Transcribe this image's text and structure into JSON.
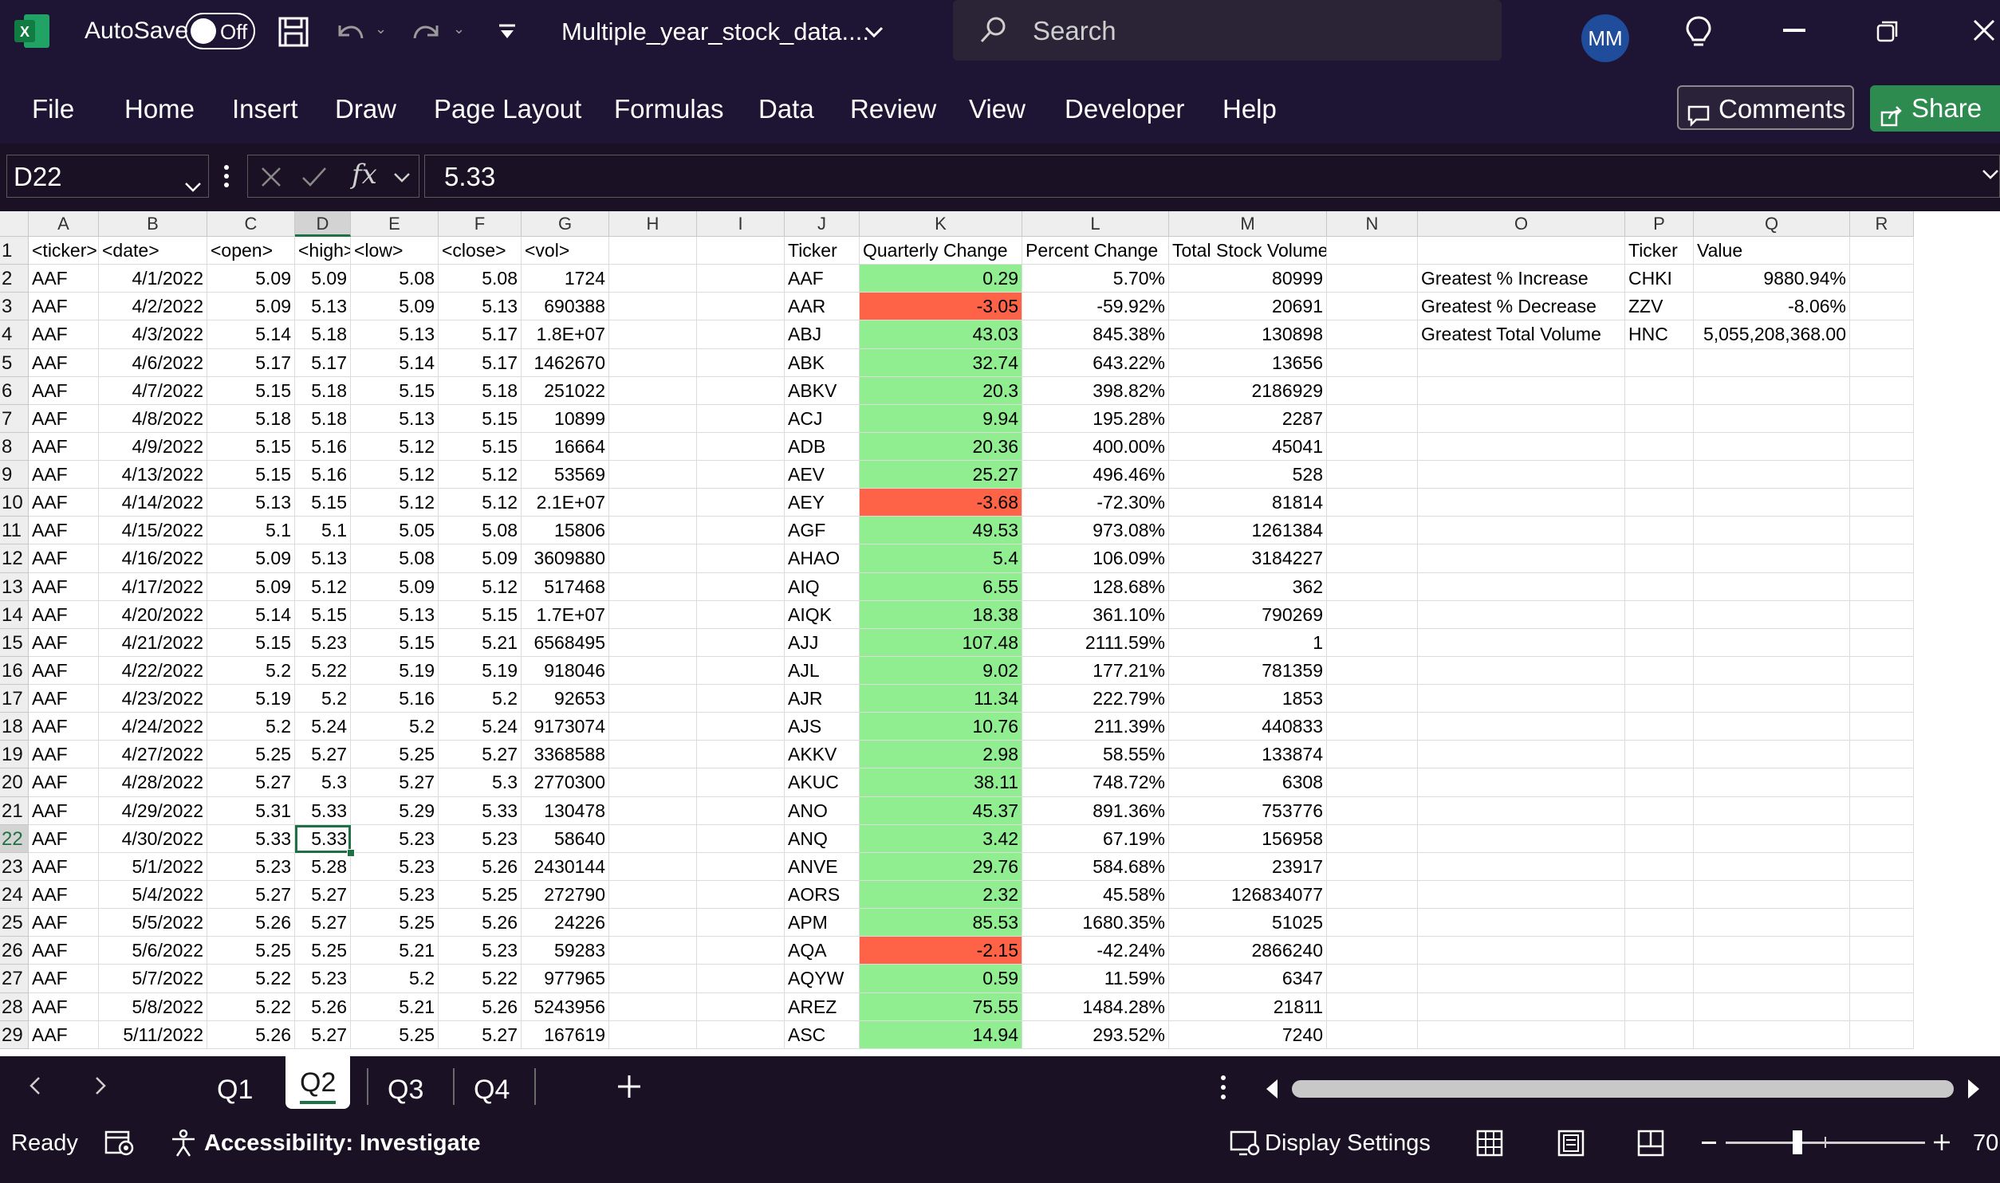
{
  "titlebar": {
    "autosave_label": "AutoSave",
    "autosave_state": "Off",
    "filename": "Multiple_year_stock_data....",
    "search_placeholder": "Search",
    "avatar_initials": "MM"
  },
  "ribbon": {
    "tabs": [
      "File",
      "Home",
      "Insert",
      "Draw",
      "Page Layout",
      "Formulas",
      "Data",
      "Review",
      "View",
      "Developer",
      "Help"
    ],
    "comments_label": "Comments",
    "share_label": "Share"
  },
  "formula_bar": {
    "name_box": "D22",
    "fx_label": "fx",
    "value": "5.33"
  },
  "columns": [
    "A",
    "B",
    "C",
    "D",
    "E",
    "F",
    "G",
    "H",
    "I",
    "J",
    "K",
    "L",
    "M",
    "N",
    "O",
    "P",
    "Q",
    "R"
  ],
  "selected_column": "D",
  "selected_row": 22,
  "active_cell": "D22",
  "row_numbers": [
    1,
    2,
    3,
    4,
    5,
    6,
    7,
    8,
    9,
    10,
    11,
    12,
    13,
    14,
    15,
    16,
    17,
    18,
    19,
    20,
    21,
    22,
    23,
    24,
    25,
    26,
    27,
    28,
    29
  ],
  "raw_headers": [
    "<ticker>",
    "<date>",
    "<open>",
    "<high>",
    "<low>",
    "<close>",
    "<vol>"
  ],
  "raw_rows": [
    [
      "AAF",
      "4/1/2022",
      "5.09",
      "5.09",
      "5.08",
      "5.08",
      "1724"
    ],
    [
      "AAF",
      "4/2/2022",
      "5.09",
      "5.13",
      "5.09",
      "5.13",
      "690388"
    ],
    [
      "AAF",
      "4/3/2022",
      "5.14",
      "5.18",
      "5.13",
      "5.17",
      "1.8E+07"
    ],
    [
      "AAF",
      "4/6/2022",
      "5.17",
      "5.17",
      "5.14",
      "5.17",
      "1462670"
    ],
    [
      "AAF",
      "4/7/2022",
      "5.15",
      "5.18",
      "5.15",
      "5.18",
      "251022"
    ],
    [
      "AAF",
      "4/8/2022",
      "5.18",
      "5.18",
      "5.13",
      "5.15",
      "10899"
    ],
    [
      "AAF",
      "4/9/2022",
      "5.15",
      "5.16",
      "5.12",
      "5.15",
      "16664"
    ],
    [
      "AAF",
      "4/13/2022",
      "5.15",
      "5.16",
      "5.12",
      "5.12",
      "53569"
    ],
    [
      "AAF",
      "4/14/2022",
      "5.13",
      "5.15",
      "5.12",
      "5.12",
      "2.1E+07"
    ],
    [
      "AAF",
      "4/15/2022",
      "5.1",
      "5.1",
      "5.05",
      "5.08",
      "15806"
    ],
    [
      "AAF",
      "4/16/2022",
      "5.09",
      "5.13",
      "5.08",
      "5.09",
      "3609880"
    ],
    [
      "AAF",
      "4/17/2022",
      "5.09",
      "5.12",
      "5.09",
      "5.12",
      "517468"
    ],
    [
      "AAF",
      "4/20/2022",
      "5.14",
      "5.15",
      "5.13",
      "5.15",
      "1.7E+07"
    ],
    [
      "AAF",
      "4/21/2022",
      "5.15",
      "5.23",
      "5.15",
      "5.21",
      "6568495"
    ],
    [
      "AAF",
      "4/22/2022",
      "5.2",
      "5.22",
      "5.19",
      "5.19",
      "918046"
    ],
    [
      "AAF",
      "4/23/2022",
      "5.19",
      "5.2",
      "5.16",
      "5.2",
      "92653"
    ],
    [
      "AAF",
      "4/24/2022",
      "5.2",
      "5.24",
      "5.2",
      "5.24",
      "9173074"
    ],
    [
      "AAF",
      "4/27/2022",
      "5.25",
      "5.27",
      "5.25",
      "5.27",
      "3368588"
    ],
    [
      "AAF",
      "4/28/2022",
      "5.27",
      "5.3",
      "5.27",
      "5.3",
      "2770300"
    ],
    [
      "AAF",
      "4/29/2022",
      "5.31",
      "5.33",
      "5.29",
      "5.33",
      "130478"
    ],
    [
      "AAF",
      "4/30/2022",
      "5.33",
      "5.33",
      "5.23",
      "5.23",
      "58640"
    ],
    [
      "AAF",
      "5/1/2022",
      "5.23",
      "5.28",
      "5.23",
      "5.26",
      "2430144"
    ],
    [
      "AAF",
      "5/4/2022",
      "5.27",
      "5.27",
      "5.23",
      "5.25",
      "272790"
    ],
    [
      "AAF",
      "5/5/2022",
      "5.26",
      "5.27",
      "5.25",
      "5.26",
      "24226"
    ],
    [
      "AAF",
      "5/6/2022",
      "5.25",
      "5.25",
      "5.21",
      "5.23",
      "59283"
    ],
    [
      "AAF",
      "5/7/2022",
      "5.22",
      "5.23",
      "5.2",
      "5.22",
      "977965"
    ],
    [
      "AAF",
      "5/8/2022",
      "5.22",
      "5.26",
      "5.21",
      "5.26",
      "5243956"
    ],
    [
      "AAF",
      "5/11/2022",
      "5.26",
      "5.27",
      "5.25",
      "5.27",
      "167619"
    ]
  ],
  "summary_headers": [
    "Ticker",
    "Quarterly Change",
    "Percent Change",
    "Total Stock Volume"
  ],
  "summary_rows": [
    [
      "AAF",
      "0.29",
      "5.70%",
      "80999",
      "pos"
    ],
    [
      "AAR",
      "-3.05",
      "-59.92%",
      "20691",
      "neg"
    ],
    [
      "ABJ",
      "43.03",
      "845.38%",
      "130898",
      "pos"
    ],
    [
      "ABK",
      "32.74",
      "643.22%",
      "13656",
      "pos"
    ],
    [
      "ABKV",
      "20.3",
      "398.82%",
      "2186929",
      "pos"
    ],
    [
      "ACJ",
      "9.94",
      "195.28%",
      "2287",
      "pos"
    ],
    [
      "ADB",
      "20.36",
      "400.00%",
      "45041",
      "pos"
    ],
    [
      "AEV",
      "25.27",
      "496.46%",
      "528",
      "pos"
    ],
    [
      "AEY",
      "-3.68",
      "-72.30%",
      "81814",
      "neg"
    ],
    [
      "AGF",
      "49.53",
      "973.08%",
      "1261384",
      "pos"
    ],
    [
      "AHAO",
      "5.4",
      "106.09%",
      "3184227",
      "pos"
    ],
    [
      "AIQ",
      "6.55",
      "128.68%",
      "362",
      "pos"
    ],
    [
      "AIQK",
      "18.38",
      "361.10%",
      "790269",
      "pos"
    ],
    [
      "AJJ",
      "107.48",
      "2111.59%",
      "1",
      "pos"
    ],
    [
      "AJL",
      "9.02",
      "177.21%",
      "781359",
      "pos"
    ],
    [
      "AJR",
      "11.34",
      "222.79%",
      "1853",
      "pos"
    ],
    [
      "AJS",
      "10.76",
      "211.39%",
      "440833",
      "pos"
    ],
    [
      "AKKV",
      "2.98",
      "58.55%",
      "133874",
      "pos"
    ],
    [
      "AKUC",
      "38.11",
      "748.72%",
      "6308",
      "pos"
    ],
    [
      "ANO",
      "45.37",
      "891.36%",
      "753776",
      "pos"
    ],
    [
      "ANQ",
      "3.42",
      "67.19%",
      "156958",
      "pos"
    ],
    [
      "ANVE",
      "29.76",
      "584.68%",
      "23917",
      "pos"
    ],
    [
      "AORS",
      "2.32",
      "45.58%",
      "126834077",
      "pos"
    ],
    [
      "APM",
      "85.53",
      "1680.35%",
      "51025",
      "pos"
    ],
    [
      "AQA",
      "-2.15",
      "-42.24%",
      "2866240",
      "neg"
    ],
    [
      "AQYW",
      "0.59",
      "11.59%",
      "6347",
      "pos"
    ],
    [
      "AREZ",
      "75.55",
      "1484.28%",
      "21811",
      "pos"
    ],
    [
      "ASC",
      "14.94",
      "293.52%",
      "7240",
      "pos"
    ]
  ],
  "greatest_headers": [
    "Ticker",
    "Value"
  ],
  "greatest_rows": [
    [
      "Greatest % Increase",
      "CHKI",
      "9880.94%"
    ],
    [
      "Greatest % Decrease",
      "ZZV",
      "-8.06%"
    ],
    [
      "Greatest Total Volume",
      "HNC",
      "5,055,208,368.00"
    ]
  ],
  "sheet_tabs": [
    "Q1",
    "Q2",
    "Q3",
    "Q4"
  ],
  "selected_sheet": "Q2",
  "statusbar": {
    "ready": "Ready",
    "accessibility": "Accessibility: Investigate",
    "display_settings": "Display Settings",
    "zoom": "70"
  },
  "colors": {
    "positive_fill": "#90ee90",
    "negative_fill": "#ff6347",
    "accent_green": "#1e7145",
    "titlebar_bg": "#1e1433"
  }
}
